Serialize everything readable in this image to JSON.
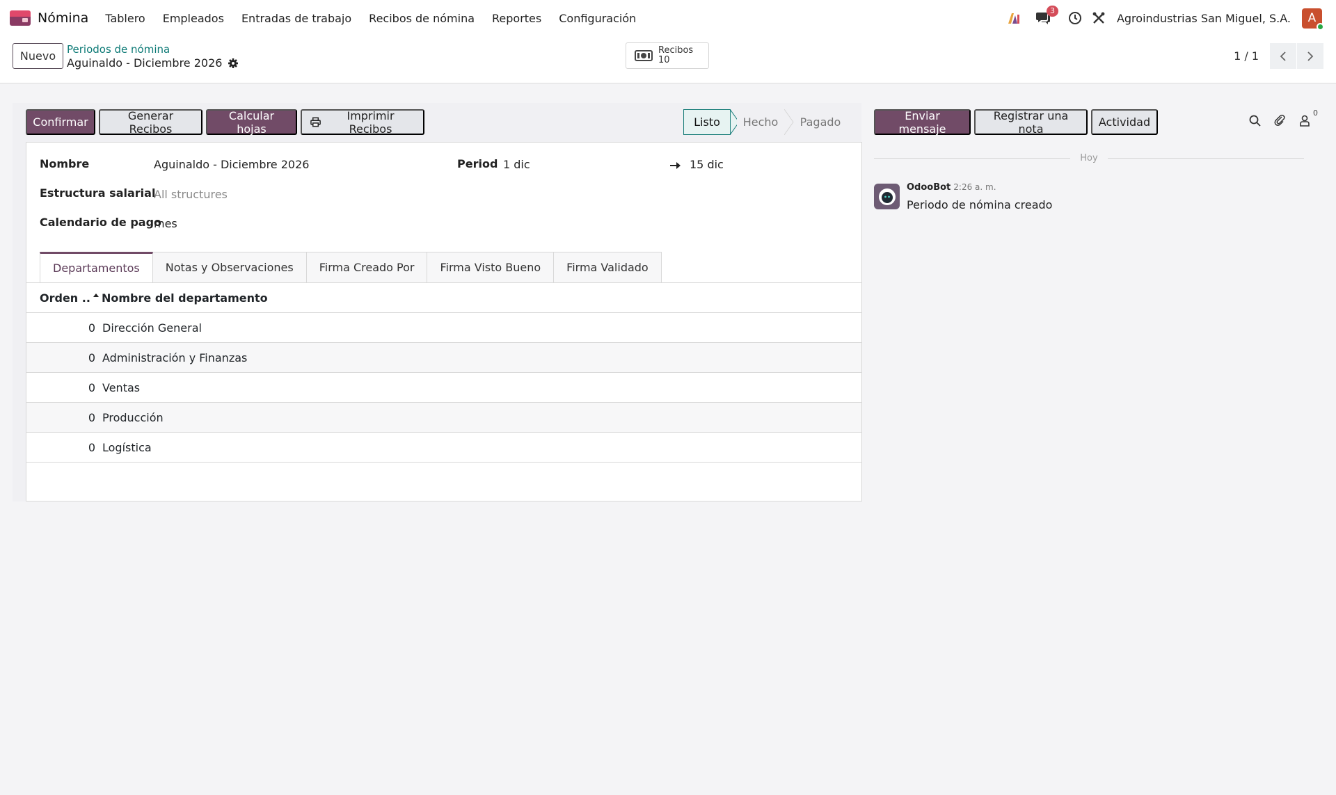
{
  "navbar": {
    "app_name": "Nómina",
    "menu": [
      "Tablero",
      "Empleados",
      "Entradas de trabajo",
      "Recibos de nómina",
      "Reportes",
      "Configuración"
    ],
    "messages_count": "3",
    "company": "Agroindustrias San Miguel, S.A.",
    "avatar_initial": "A"
  },
  "control_panel": {
    "new_label": "Nuevo",
    "breadcrumb_parent": "Periodos de nómina",
    "breadcrumb_current": "Aguinaldo - Diciembre 2026",
    "smart_button": {
      "label": "Recibos",
      "count": "10"
    },
    "pager": "1 / 1"
  },
  "statusbar": {
    "buttons": [
      "Confirmar",
      "Generar Recibos",
      "Calcular hojas",
      "Imprimir Recibos"
    ],
    "steps": [
      "Listo",
      "Hecho",
      "Pagado"
    ],
    "active_step": "Listo"
  },
  "form": {
    "name_label": "Nombre",
    "name_value": "Aguinaldo - Diciembre 2026",
    "structure_label": "Estructura salarial",
    "structure_placeholder": "All structures",
    "calendar_label": "Calendario de pago",
    "calendar_value": "mes",
    "period_label": "Period",
    "period_start": "1 dic",
    "period_end": "15 dic"
  },
  "tabs": [
    "Departamentos",
    "Notas y Observaciones",
    "Firma Creado Por",
    "Firma Visto Bueno",
    "Firma Validado"
  ],
  "table": {
    "headers": [
      "Orden ..",
      "Nombre del departamento"
    ],
    "rows": [
      {
        "order": "0",
        "name": "Dirección General"
      },
      {
        "order": "0",
        "name": "Administración y Finanzas"
      },
      {
        "order": "0",
        "name": "Ventas"
      },
      {
        "order": "0",
        "name": "Producción"
      },
      {
        "order": "0",
        "name": "Logística"
      }
    ]
  },
  "chatter": {
    "send_message": "Enviar mensaje",
    "log_note": "Registrar una nota",
    "activity": "Actividad",
    "followers_count": "0",
    "day_label": "Hoy",
    "message": {
      "author": "OdooBot",
      "time": "2:26 a. m.",
      "body": "Periodo de nómina creado"
    }
  },
  "colors": {
    "primary": "#714b67",
    "teal": "#0d7a76",
    "badge": "#d44c59"
  }
}
